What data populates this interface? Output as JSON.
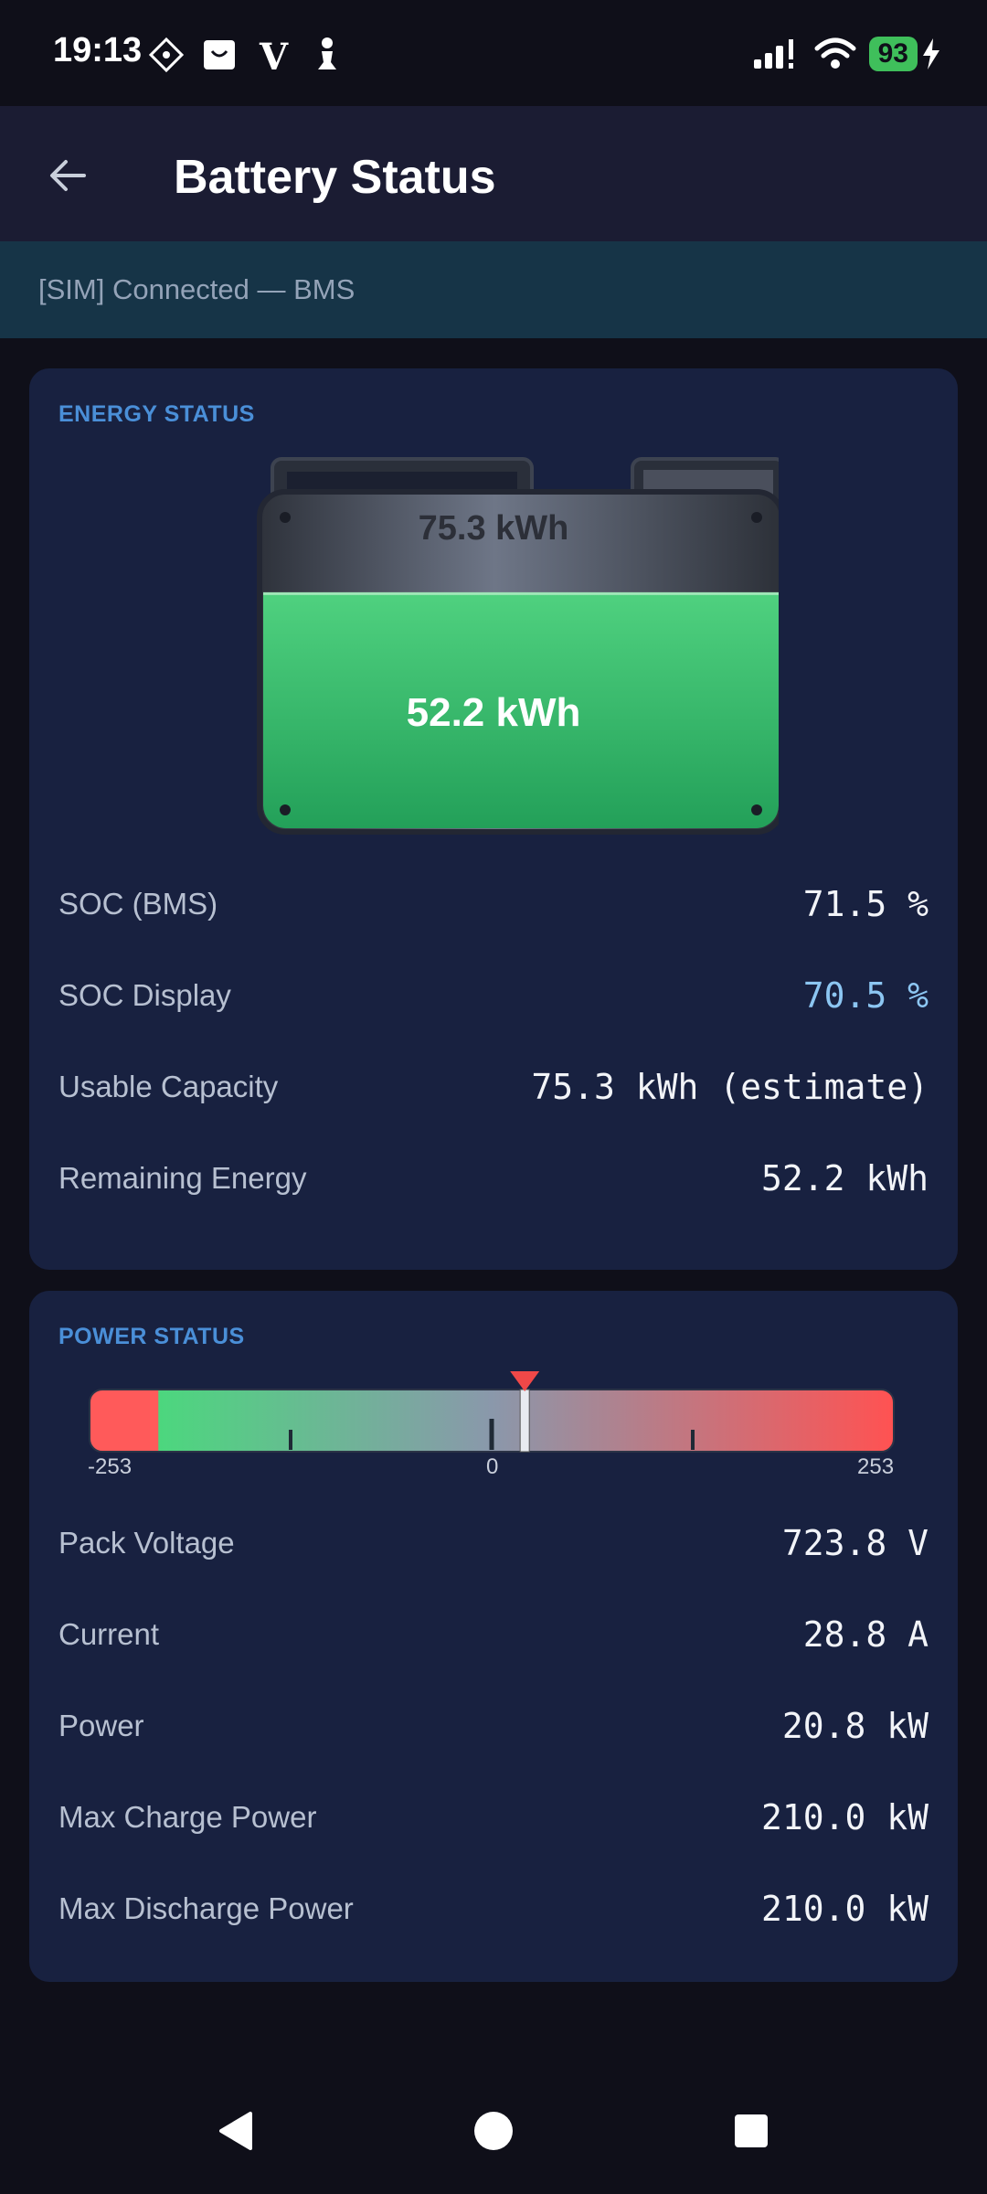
{
  "status_bar": {
    "time": "19:13",
    "battery_level": "93",
    "icons": [
      "notification-icon",
      "shopping-bag-icon",
      "v-app-icon",
      "chess-icon",
      "signal-icon",
      "wifi-icon",
      "battery-icon",
      "charging-bolt-icon"
    ]
  },
  "app_bar": {
    "title": "Battery Status",
    "back_icon": "arrow-left-icon"
  },
  "banner": {
    "text": "[SIM] Connected — BMS"
  },
  "energy": {
    "section_title": "ENERGY STATUS",
    "battery_capacity_label": "75.3 kWh",
    "battery_remaining_label": "52.2 kWh",
    "battery_fill_fraction": 0.705,
    "rows": [
      {
        "label": "SOC (BMS)",
        "value": "71.5 %"
      },
      {
        "label": "SOC Display",
        "value": "70.5 %"
      },
      {
        "label": "Usable Capacity",
        "value": "75.3 kWh (estimate)"
      },
      {
        "label": "Remaining Energy",
        "value": "52.2 kWh"
      }
    ]
  },
  "power": {
    "section_title": "POWER STATUS",
    "gauge": {
      "min": "-253",
      "zero": "0",
      "max": "253",
      "min_value": -253,
      "max_value": 253,
      "current_value": 20.8
    },
    "rows": [
      {
        "label": "Pack Voltage",
        "value": "723.8 V"
      },
      {
        "label": "Current",
        "value": "28.8 A"
      },
      {
        "label": "Power",
        "value": "20.8 kW"
      },
      {
        "label": "Max Charge Power",
        "value": "210.0 kW"
      },
      {
        "label": "Max Discharge Power",
        "value": "210.0 kW"
      }
    ]
  },
  "nav": {
    "back_icon": "nav-back-icon",
    "home_icon": "nav-home-icon",
    "recents_icon": "nav-recents-icon"
  }
}
